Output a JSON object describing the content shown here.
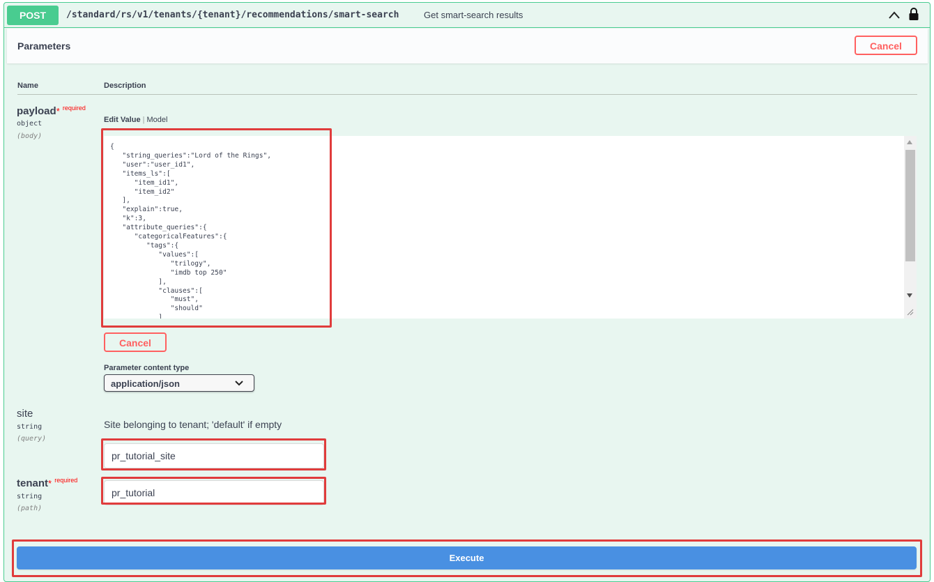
{
  "summary": {
    "method": "POST",
    "path": "/standard/rs/v1/tenants/{tenant}/recommendations/smart-search",
    "description": "Get smart-search results",
    "collapse_icon": "chevron-up-icon",
    "lock_icon": "lock-icon"
  },
  "parameters": {
    "title": "Parameters",
    "cancel_label": "Cancel",
    "column_name": "Name",
    "column_description": "Description",
    "accent_color": "#49cc90",
    "highlight_color": "#e03c3c"
  },
  "payload": {
    "name": "payload",
    "star": "*",
    "required_label": "required",
    "type": "object",
    "in": "(body)",
    "tab_edit": "Edit Value",
    "tab_model": "Model",
    "body": "{\n   \"string_queries\":\"Lord of the Rings\",\n   \"user\":\"user_id1\",\n   \"items_ls\":[\n      \"item_id1\",\n      \"item_id2\"\n   ],\n   \"explain\":true,\n   \"k\":3,\n   \"attribute_queries\":{\n      \"categoricalFeatures\":{\n         \"tags\":{\n            \"values\":[\n               \"trilogy\",\n               \"imdb top 250\"\n            ],\n            \"clauses\":[\n               \"must\",\n               \"should\"\n            ]",
    "cancel_label": "Cancel",
    "content_type_label": "Parameter content type",
    "content_type_value": "application/json"
  },
  "site": {
    "name": "site",
    "type": "string",
    "in": "(query)",
    "description": "Site belonging to tenant; 'default' if empty",
    "value": "pr_tutorial_site"
  },
  "tenant": {
    "name": "tenant",
    "star": "*",
    "required_label": "required",
    "type": "string",
    "in": "(path)",
    "value": "pr_tutorial"
  },
  "execute": {
    "label": "Execute",
    "color": "#4990e2"
  }
}
